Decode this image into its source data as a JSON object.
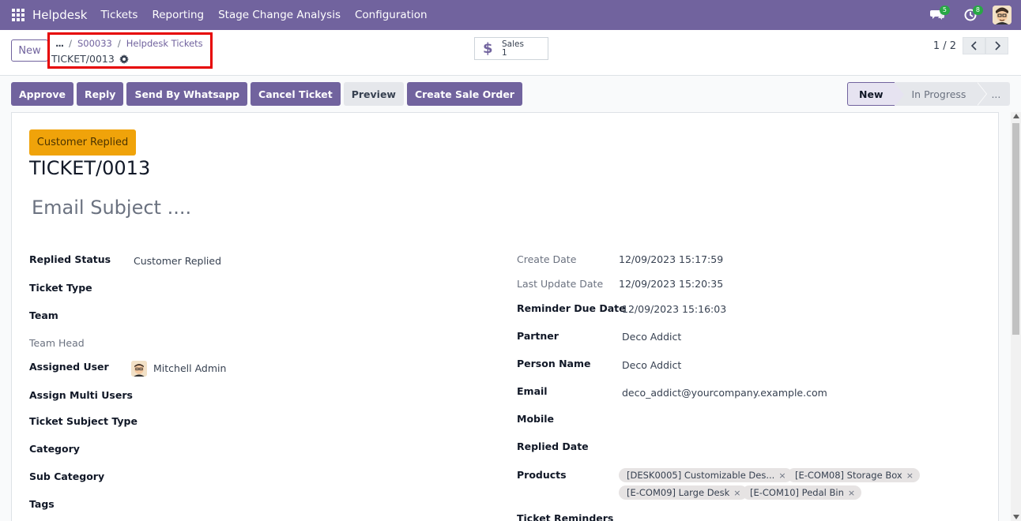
{
  "navbar": {
    "brand": "Helpdesk",
    "menu": [
      "Tickets",
      "Reporting",
      "Stage Change Analysis",
      "Configuration"
    ],
    "chat_badge": "5",
    "activity_badge": "8"
  },
  "control_panel": {
    "new_label": "New",
    "breadcrumb": {
      "more": "...",
      "items": [
        "S00033",
        "Helpdesk Tickets"
      ]
    },
    "record_name": "TICKET/0013",
    "smart_button": {
      "label": "Sales",
      "count": "1"
    },
    "pager": {
      "value": "1 / 2"
    }
  },
  "actions": [
    "Approve",
    "Reply",
    "Send By Whatsapp",
    "Cancel Ticket",
    "Preview",
    "Create Sale Order"
  ],
  "statusbar": [
    "New",
    "In Progress",
    "..."
  ],
  "form": {
    "status_badge": "Customer Replied",
    "title": "TICKET/0013",
    "subject_placeholder": "Email Subject ....",
    "left": [
      {
        "label": "Replied Status",
        "value": "Customer Replied"
      },
      {
        "label": "Ticket Type",
        "value": ""
      },
      {
        "label": "Team",
        "value": ""
      },
      {
        "label": "Team Head",
        "value": ""
      },
      {
        "label": "Assigned User",
        "value": "Mitchell Admin"
      },
      {
        "label": "Assign Multi Users",
        "value": ""
      },
      {
        "label": "Ticket Subject Type",
        "value": ""
      },
      {
        "label": "Category",
        "value": ""
      },
      {
        "label": "Sub Category",
        "value": ""
      },
      {
        "label": "Tags",
        "value": ""
      }
    ],
    "right": [
      {
        "label": "Create Date",
        "value": "12/09/2023 15:17:59"
      },
      {
        "label": "Last Update Date",
        "value": "12/09/2023 15:20:35"
      },
      {
        "label": "Reminder Due Date",
        "value": "12/09/2023 15:16:03"
      },
      {
        "label": "Partner",
        "value": "Deco Addict"
      },
      {
        "label": "Person Name",
        "value": "Deco Addict"
      },
      {
        "label": "Email",
        "value": "deco_addict@yourcompany.example.com"
      },
      {
        "label": "Mobile",
        "value": ""
      },
      {
        "label": "Replied Date",
        "value": ""
      },
      {
        "label": "Products",
        "value": ""
      },
      {
        "label": "Ticket Reminders",
        "value": ""
      }
    ],
    "products": [
      "[DESK0005] Customizable Des...",
      "[E-COM08] Storage Box",
      "[E-COM09] Large Desk",
      "[E-COM10] Pedal Bin"
    ],
    "tag_remove": "×"
  },
  "colors": {
    "brand": "#71639e",
    "badge": "#f0a30a",
    "highlight_box": "#e60000"
  }
}
